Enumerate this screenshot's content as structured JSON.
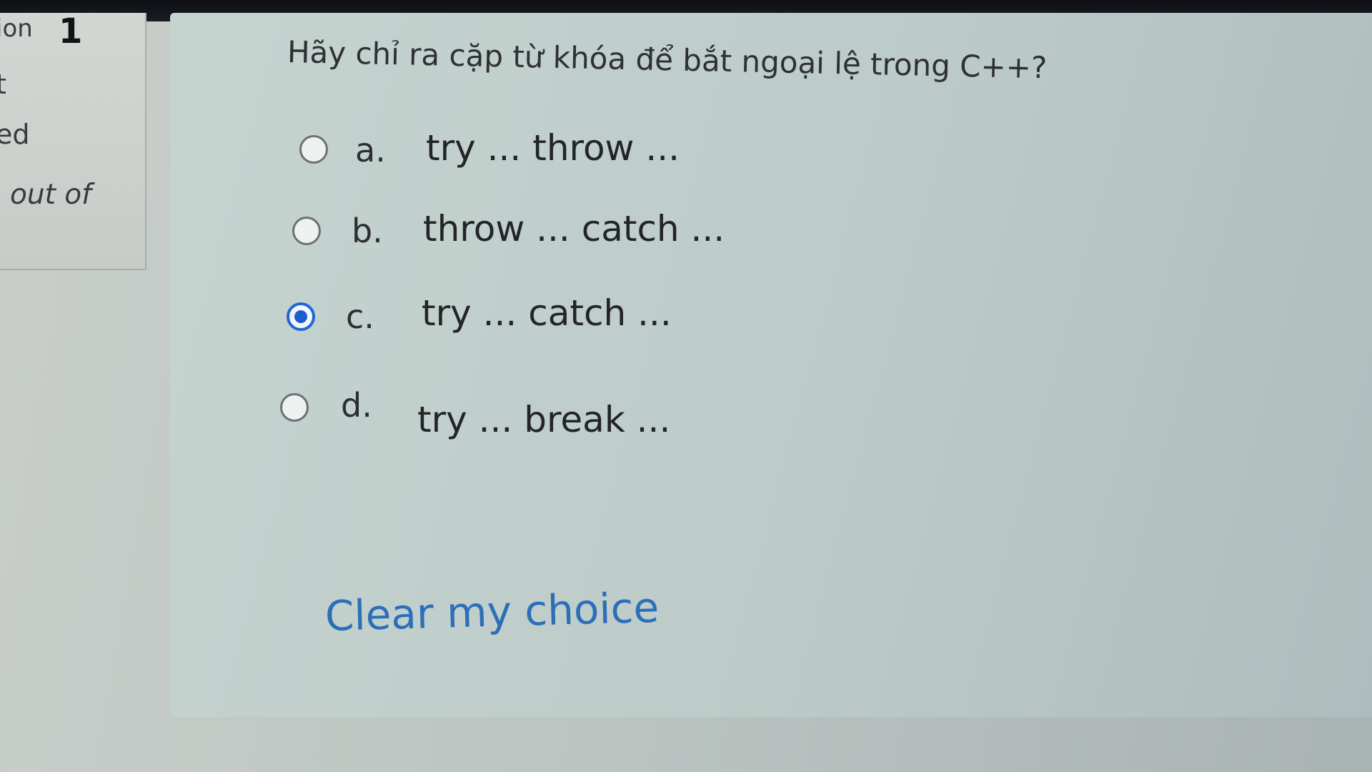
{
  "sidebar": {
    "question_label": "ion",
    "question_number": "1",
    "state_text": "t",
    "status_text": "ed",
    "mark_text": "out of"
  },
  "question": {
    "text": "Hãy chỉ ra cặp từ khóa để bắt ngoại lệ trong C++?",
    "answers": [
      {
        "letter": "a.",
        "text": "try ... throw ...",
        "selected": false
      },
      {
        "letter": "b.",
        "text": "throw ... catch ...",
        "selected": false
      },
      {
        "letter": "c.",
        "text": "try ... catch ...",
        "selected": true
      },
      {
        "letter": "d.",
        "text": "try ... break ...",
        "selected": false
      }
    ],
    "clear_label": "Clear my choice"
  },
  "colors": {
    "selected_radio": "#1b5fcf",
    "link": "#2c6fb8"
  }
}
